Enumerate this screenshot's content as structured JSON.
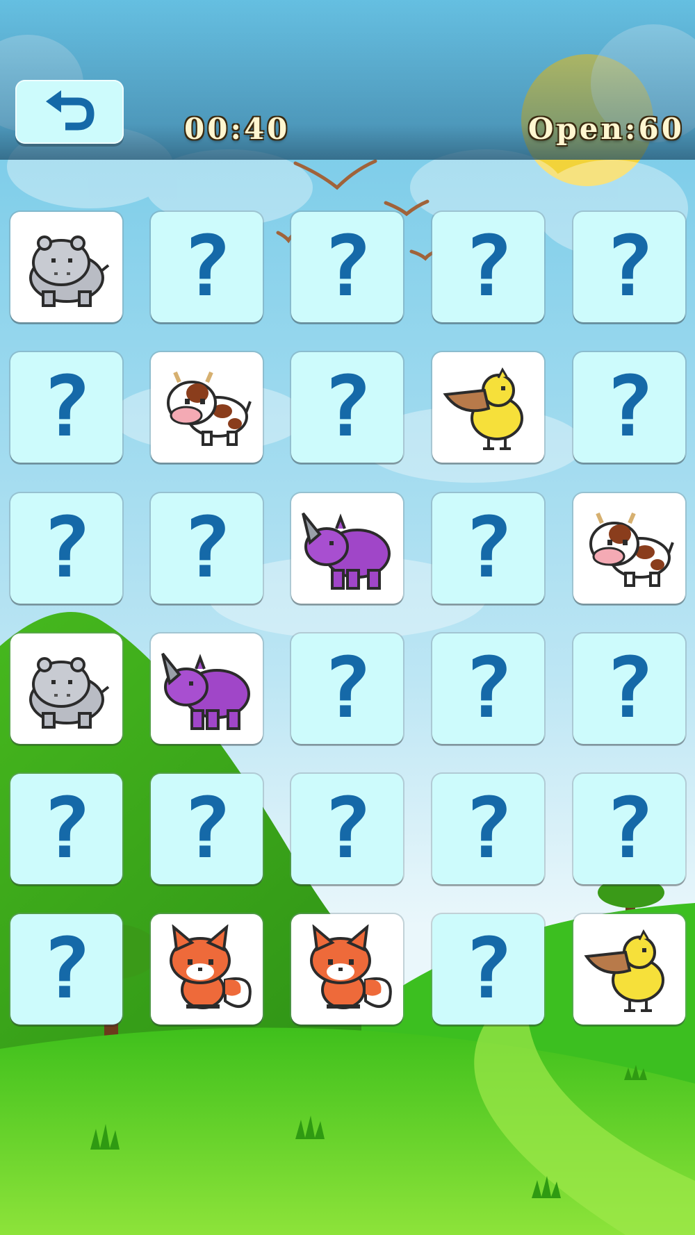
{
  "hud": {
    "timer": "00:40",
    "open_count": "Open:60",
    "back_icon": "undo-arrow-icon"
  },
  "board": {
    "rows": 6,
    "cols": 5,
    "hidden_symbol": "?",
    "cards": [
      {
        "state": "revealed",
        "animal": "hippo"
      },
      {
        "state": "hidden"
      },
      {
        "state": "hidden"
      },
      {
        "state": "hidden"
      },
      {
        "state": "hidden"
      },
      {
        "state": "hidden"
      },
      {
        "state": "revealed",
        "animal": "cow"
      },
      {
        "state": "hidden"
      },
      {
        "state": "revealed",
        "animal": "pelican"
      },
      {
        "state": "hidden"
      },
      {
        "state": "hidden"
      },
      {
        "state": "hidden"
      },
      {
        "state": "revealed",
        "animal": "rhino"
      },
      {
        "state": "hidden"
      },
      {
        "state": "revealed",
        "animal": "cow"
      },
      {
        "state": "revealed",
        "animal": "hippo"
      },
      {
        "state": "revealed",
        "animal": "rhino"
      },
      {
        "state": "hidden"
      },
      {
        "state": "hidden"
      },
      {
        "state": "hidden"
      },
      {
        "state": "hidden"
      },
      {
        "state": "hidden"
      },
      {
        "state": "hidden"
      },
      {
        "state": "hidden"
      },
      {
        "state": "hidden"
      },
      {
        "state": "hidden"
      },
      {
        "state": "revealed",
        "animal": "fox"
      },
      {
        "state": "revealed",
        "animal": "fox"
      },
      {
        "state": "hidden"
      },
      {
        "state": "revealed",
        "animal": "pelican"
      }
    ]
  },
  "colors": {
    "card_hidden": "#cdfbfc",
    "card_revealed": "#ffffff",
    "question_mark": "#1569a8",
    "hud_text": "#fff6d0",
    "sky_top": "#6cc6e6",
    "sky_bottom": "#e8f6fb",
    "sun": "#f2d33a",
    "grass": "#46c21e"
  }
}
